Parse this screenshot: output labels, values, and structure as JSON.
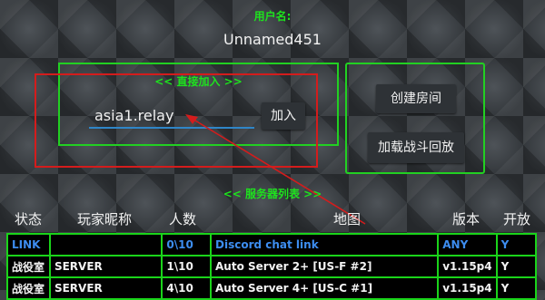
{
  "username": {
    "title": "用户名:",
    "value": "Unnamed451"
  },
  "direct_join": {
    "title": "<< 直接加入 >>",
    "host_value": "asia1.relay",
    "join_label": "加入"
  },
  "actions": {
    "create_room_label": "创建房间",
    "load_replay_label": "加载战斗回放"
  },
  "server_list": {
    "title": "<< 服务器列表 >>",
    "columns": [
      "状态",
      "玩家昵称",
      "人数",
      "地图",
      "版本",
      "开放"
    ],
    "rows": [
      {
        "status": "LINK",
        "name": "",
        "players": "0\\10",
        "map": "Discord chat link",
        "version": "ANY",
        "open": "Y"
      },
      {
        "status": "战役室",
        "name": "SERVER",
        "players": "1\\10",
        "map": "Auto Server 2+ [US-F #2]",
        "version": "v1.15p4",
        "open": "Y"
      },
      {
        "status": "战役室",
        "name": "SERVER",
        "players": "4\\10",
        "map": "Auto Server 4+ [US-C #1]",
        "version": "v1.15p4",
        "open": "Y"
      }
    ]
  },
  "colors": {
    "accent_green": "#1ee21e",
    "highlight_red": "#d41c1c",
    "link_blue": "#3d8df0",
    "input_underline": "#2f86c8"
  }
}
